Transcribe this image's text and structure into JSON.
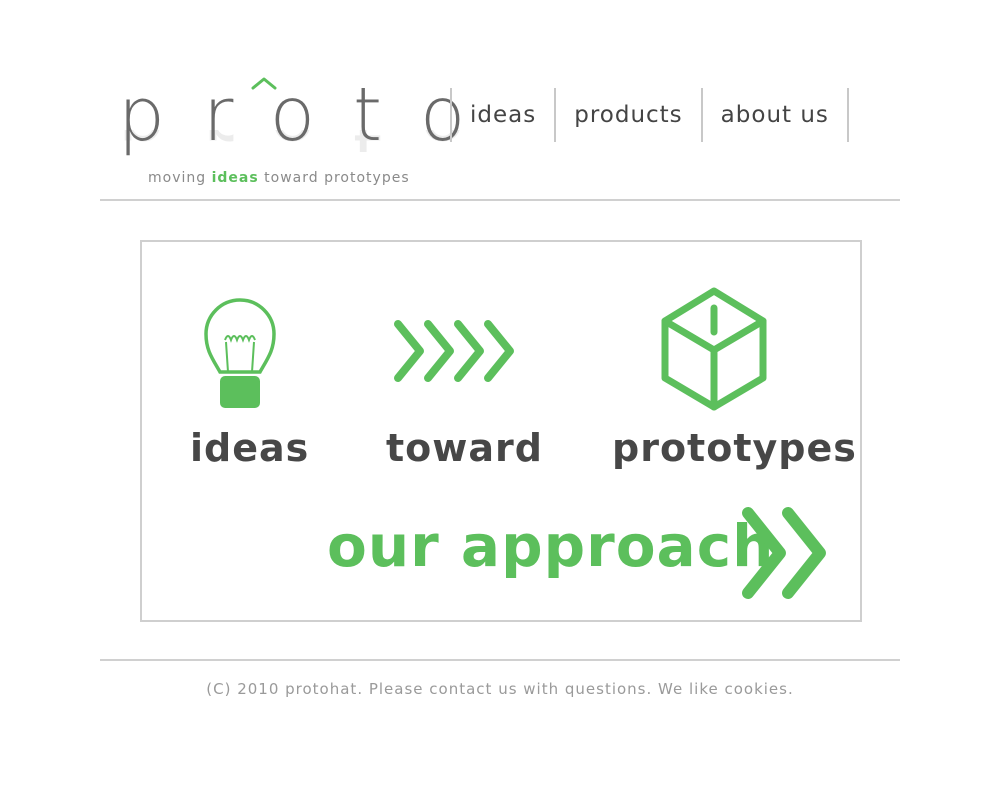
{
  "logo": {
    "word": "proto"
  },
  "tagline": {
    "pre": "moving",
    "highlight": "ideas",
    "post": "toward prototypes"
  },
  "nav": {
    "items": [
      "ideas",
      "products",
      "about us"
    ]
  },
  "hero": {
    "steps": [
      {
        "label": "ideas",
        "icon": "lightbulb-icon"
      },
      {
        "label": "toward",
        "icon": "chevrons-icon"
      },
      {
        "label": "prototypes",
        "icon": "box-icon"
      }
    ],
    "cta_label": "our approach",
    "cta_icon": "double-chevron-icon"
  },
  "footer": {
    "text": "(C) 2010 protohat. Please contact us with questions. We like cookies."
  },
  "colors": {
    "accent": "#5cbf5c",
    "text": "#444444",
    "muted": "#9a9a9a",
    "rule": "#d0d0d0"
  }
}
